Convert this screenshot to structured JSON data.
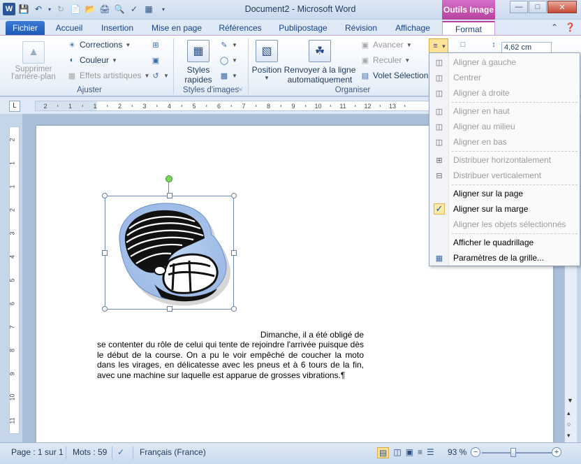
{
  "titlebar": {
    "title": "Document2 - Microsoft Word",
    "context_tab": "Outils Image",
    "app_icon": "W"
  },
  "tabs": [
    {
      "label": "Fichier"
    },
    {
      "label": "Accueil"
    },
    {
      "label": "Insertion"
    },
    {
      "label": "Mise en page"
    },
    {
      "label": "Références"
    },
    {
      "label": "Publipostage"
    },
    {
      "label": "Révision"
    },
    {
      "label": "Affichage"
    },
    {
      "label": "Format"
    }
  ],
  "ribbon": {
    "ajuster": {
      "remove_bg_line1": "Supprimer",
      "remove_bg_line2": "l'arrière-plan",
      "corrections": "Corrections",
      "couleur": "Couleur",
      "effets": "Effets artistiques",
      "group": "Ajuster"
    },
    "styles": {
      "styles_line1": "Styles",
      "styles_line2": "rapides",
      "group": "Styles d'images"
    },
    "organiser": {
      "position": "Position",
      "wrap_line1": "Renvoyer à la ligne",
      "wrap_line2": "automatiquement",
      "avancer": "Avancer",
      "reculer": "Reculer",
      "volet": "Volet Sélection",
      "group": "Organiser"
    },
    "size_value": "4,62 cm"
  },
  "align_menu": {
    "items": [
      {
        "label": "Aligner à gauche",
        "icon": "align-left-icon"
      },
      {
        "label": "Centrer",
        "icon": "align-center-icon"
      },
      {
        "label": "Aligner à droite",
        "icon": "align-right-icon"
      },
      {
        "label": "Aligner en haut",
        "icon": "align-top-icon"
      },
      {
        "label": "Aligner au milieu",
        "icon": "align-middle-icon"
      },
      {
        "label": "Aligner en bas",
        "icon": "align-bottom-icon"
      },
      {
        "label": "Distribuer horizontalement",
        "icon": "distribute-horizontal-icon"
      },
      {
        "label": "Distribuer verticalement",
        "icon": "distribute-vertical-icon"
      },
      {
        "label": "Aligner sur la page",
        "icon": ""
      },
      {
        "label": "Aligner sur la marge",
        "icon": "checkmark-icon"
      },
      {
        "label": "Aligner les objets sélectionnés",
        "icon": ""
      },
      {
        "label": "Afficher le quadrillage",
        "icon": ""
      },
      {
        "label": "Paramètres de la grille...",
        "icon": "grid-icon"
      }
    ]
  },
  "document": {
    "first_line": "Dimanche, il a été obligé de",
    "rest": "se contenter du rôle de celui qui tente de rejoindre l'arrivée puisque dès le début de la course. On a pu le voir empêché de coucher la moto dans les virages, en délicatesse avec les pneus et à 6 tours de la fin, avec une machine sur laquelle est apparue de grosses vibrations.¶"
  },
  "ruler": {
    "h_ticks": [
      "2",
      "1",
      "1",
      "2",
      "3",
      "4",
      "5",
      "6",
      "7",
      "8",
      "9",
      "10",
      "11",
      "12",
      "13"
    ],
    "v_ticks": [
      "2",
      "1",
      "1",
      "2",
      "3",
      "4",
      "5",
      "6",
      "7",
      "8",
      "9",
      "10",
      "11"
    ]
  },
  "status": {
    "page": "Page : 1 sur 1",
    "words": "Mots : 59",
    "language": "Français (France)",
    "zoom": "93 %"
  }
}
